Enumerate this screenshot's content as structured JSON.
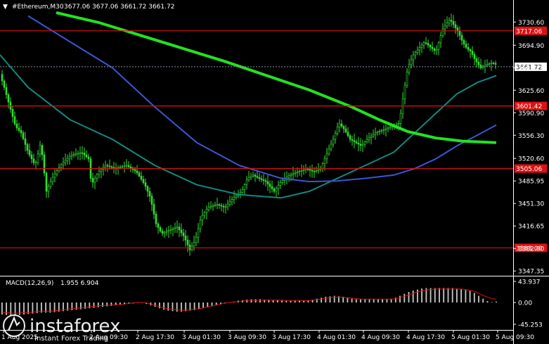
{
  "header": {
    "arrow": "▼",
    "symbol": "#Ethereum,M30",
    "ohlc": "3677.06 3677.06 3661.72 3661.72"
  },
  "macd_header": {
    "label": "MACD(12,26,9)",
    "values": "1.955 6.904"
  },
  "watermark": {
    "brand": "instaforex",
    "tagline": "Instant Forex Trading"
  },
  "colors": {
    "bull": "#33dd33",
    "ma_fast": "#0f8a80",
    "ma_mid": "#3a56d4",
    "ma_slow": "#22e222",
    "level": "#e01010",
    "current_line": "#8a94a6",
    "hist": "#c8c8c8",
    "signal": "#e01010"
  },
  "chart_data": [
    {
      "type": "candlestick",
      "symbol": "#Ethereum",
      "timeframe": "M30",
      "y_ticks": [
        "3730.60",
        "3694.90",
        "3660.25",
        "3625.60",
        "3590.90",
        "3556.30",
        "3520.60",
        "3485.95",
        "3451.30",
        "3416.65",
        "3382.00",
        "3347.35"
      ],
      "ylim": [
        3340,
        3745
      ],
      "x_ticks": [
        "1 Aug 2025",
        "2 Aug 09:30",
        "2 Aug 17:30",
        "3 Aug 01:30",
        "3 Aug 09:30",
        "3 Aug 17:30",
        "4 Aug 01:30",
        "4 Aug 09:30",
        "4 Aug 17:30",
        "5 Aug 01:30",
        "5 Aug 09:30"
      ],
      "current_price": 3661.72,
      "levels": [
        {
          "value": 3717.06,
          "label": "3717.06"
        },
        {
          "value": 3601.42,
          "label": "3601.42"
        },
        {
          "value": 3505.06,
          "label": "3505.06"
        },
        {
          "value": 3383.0,
          "label": "3383.00"
        }
      ],
      "price_path": [
        [
          0,
          3650
        ],
        [
          6,
          3630
        ],
        [
          14,
          3600
        ],
        [
          22,
          3570
        ],
        [
          30,
          3560
        ],
        [
          40,
          3530
        ],
        [
          50,
          3510
        ],
        [
          58,
          3545
        ],
        [
          66,
          3470
        ],
        [
          74,
          3490
        ],
        [
          86,
          3510
        ],
        [
          100,
          3525
        ],
        [
          116,
          3530
        ],
        [
          126,
          3520
        ],
        [
          130,
          3480
        ],
        [
          140,
          3500
        ],
        [
          150,
          3510
        ],
        [
          164,
          3505
        ],
        [
          180,
          3510
        ],
        [
          194,
          3500
        ],
        [
          206,
          3480
        ],
        [
          214,
          3460
        ],
        [
          222,
          3420
        ],
        [
          230,
          3405
        ],
        [
          240,
          3410
        ],
        [
          252,
          3415
        ],
        [
          262,
          3400
        ],
        [
          270,
          3380
        ],
        [
          278,
          3395
        ],
        [
          286,
          3430
        ],
        [
          296,
          3445
        ],
        [
          308,
          3450
        ],
        [
          320,
          3445
        ],
        [
          332,
          3460
        ],
        [
          344,
          3470
        ],
        [
          352,
          3490
        ],
        [
          360,
          3495
        ],
        [
          368,
          3490
        ],
        [
          378,
          3485
        ],
        [
          390,
          3470
        ],
        [
          400,
          3485
        ],
        [
          412,
          3495
        ],
        [
          424,
          3500
        ],
        [
          436,
          3505
        ],
        [
          446,
          3500
        ],
        [
          456,
          3505
        ],
        [
          466,
          3530
        ],
        [
          474,
          3550
        ],
        [
          482,
          3575
        ],
        [
          490,
          3565
        ],
        [
          498,
          3550
        ],
        [
          506,
          3545
        ],
        [
          514,
          3540
        ],
        [
          524,
          3552
        ],
        [
          534,
          3560
        ],
        [
          546,
          3565
        ],
        [
          558,
          3570
        ],
        [
          568,
          3575
        ],
        [
          574,
          3620
        ],
        [
          580,
          3660
        ],
        [
          588,
          3680
        ],
        [
          596,
          3690
        ],
        [
          604,
          3700
        ],
        [
          612,
          3692
        ],
        [
          620,
          3685
        ],
        [
          630,
          3720
        ],
        [
          640,
          3735
        ],
        [
          646,
          3725
        ],
        [
          652,
          3715
        ],
        [
          658,
          3700
        ],
        [
          664,
          3690
        ],
        [
          670,
          3685
        ],
        [
          676,
          3672
        ],
        [
          684,
          3660
        ],
        [
          692,
          3665
        ],
        [
          700,
          3668
        ],
        [
          706,
          3665
        ]
      ],
      "moving_averages": [
        {
          "color": "#0f8a80",
          "points": [
            [
              0,
              3680
            ],
            [
              40,
              3630
            ],
            [
              100,
              3580
            ],
            [
              160,
              3550
            ],
            [
              220,
              3510
            ],
            [
              280,
              3480
            ],
            [
              340,
              3465
            ],
            [
              400,
              3460
            ],
            [
              440,
              3470
            ],
            [
              480,
              3490
            ],
            [
              520,
              3510
            ],
            [
              560,
              3530
            ],
            [
              590,
              3560
            ],
            [
              620,
              3590
            ],
            [
              650,
              3620
            ],
            [
              680,
              3638
            ],
            [
              706,
              3648
            ]
          ]
        },
        {
          "color": "#3a56d4",
          "points": [
            [
              40,
              3740
            ],
            [
              100,
              3700
            ],
            [
              160,
              3660
            ],
            [
              220,
              3600
            ],
            [
              280,
              3545
            ],
            [
              340,
              3510
            ],
            [
              400,
              3490
            ],
            [
              440,
              3485
            ],
            [
              480,
              3486
            ],
            [
              520,
              3490
            ],
            [
              560,
              3495
            ],
            [
              590,
              3505
            ],
            [
              620,
              3520
            ],
            [
              650,
              3540
            ],
            [
              680,
              3557
            ],
            [
              706,
              3572
            ]
          ]
        },
        {
          "color": "#22e222",
          "points": [
            [
              80,
              3745
            ],
            [
              140,
              3730
            ],
            [
              200,
              3710
            ],
            [
              260,
              3690
            ],
            [
              320,
              3670
            ],
            [
              380,
              3648
            ],
            [
              440,
              3626
            ],
            [
              500,
              3600
            ],
            [
              540,
              3580
            ],
            [
              580,
              3562
            ],
            [
              620,
              3552
            ],
            [
              660,
              3547
            ],
            [
              706,
              3545
            ]
          ]
        }
      ]
    },
    {
      "type": "bar",
      "name": "MACD(12,26,9)",
      "y_ticks": [
        "43.937",
        "0.00",
        "-45.253"
      ],
      "ylim": [
        -45.253,
        43.937
      ],
      "main": 1.955,
      "signal": 6.904,
      "histogram": [
        -25,
        -26,
        -27,
        -27,
        -26,
        -25,
        -24,
        -23,
        -22,
        -21,
        -21,
        -21,
        -20,
        -19,
        -18,
        -17,
        -16,
        -15,
        -14,
        -13,
        -12,
        -11,
        -10,
        -9,
        -8,
        -7,
        -6,
        -5,
        -4,
        -3,
        -2,
        -1,
        0,
        -3,
        -6,
        -9,
        -12,
        -15,
        -17,
        -18,
        -19,
        -19,
        -18,
        -17,
        -16,
        -14,
        -12,
        -10,
        -8,
        -6,
        -4,
        -2,
        0,
        2,
        4,
        5,
        6,
        7,
        7,
        7,
        6,
        6,
        5,
        5,
        4,
        4,
        4,
        4,
        4,
        4,
        5,
        6,
        8,
        10,
        12,
        13,
        14,
        13,
        12,
        10,
        8,
        7,
        7,
        7,
        7,
        7,
        7,
        7,
        7,
        8,
        10,
        14,
        18,
        22,
        25,
        27,
        29,
        30,
        30,
        30,
        30,
        30,
        30,
        30,
        29,
        28,
        26,
        24,
        20,
        14,
        8,
        3,
        1,
        2
      ],
      "signal_line": [
        -20,
        -21,
        -22,
        -22,
        -22,
        -21,
        -21,
        -20,
        -19,
        -18,
        -18,
        -18,
        -17,
        -16,
        -15,
        -14,
        -13,
        -12,
        -11,
        -10,
        -9,
        -8,
        -7,
        -6,
        -6,
        -5,
        -5,
        -4,
        -3,
        -2,
        -1,
        0,
        0,
        -1,
        -3,
        -6,
        -9,
        -11,
        -13,
        -14,
        -15,
        -16,
        -16,
        -15,
        -14,
        -13,
        -11,
        -9,
        -7,
        -5,
        -3,
        -1,
        0,
        1,
        2,
        3,
        4,
        5,
        5,
        5,
        5,
        5,
        5,
        5,
        5,
        4,
        4,
        4,
        4,
        4,
        4,
        5,
        6,
        7,
        9,
        10,
        11,
        11,
        11,
        10,
        9,
        8,
        7,
        7,
        7,
        7,
        7,
        7,
        7,
        7,
        8,
        10,
        13,
        16,
        19,
        22,
        24,
        26,
        27,
        28,
        28,
        28,
        28,
        28,
        28,
        28,
        27,
        25,
        23,
        19,
        15,
        11,
        8,
        7
      ]
    }
  ]
}
